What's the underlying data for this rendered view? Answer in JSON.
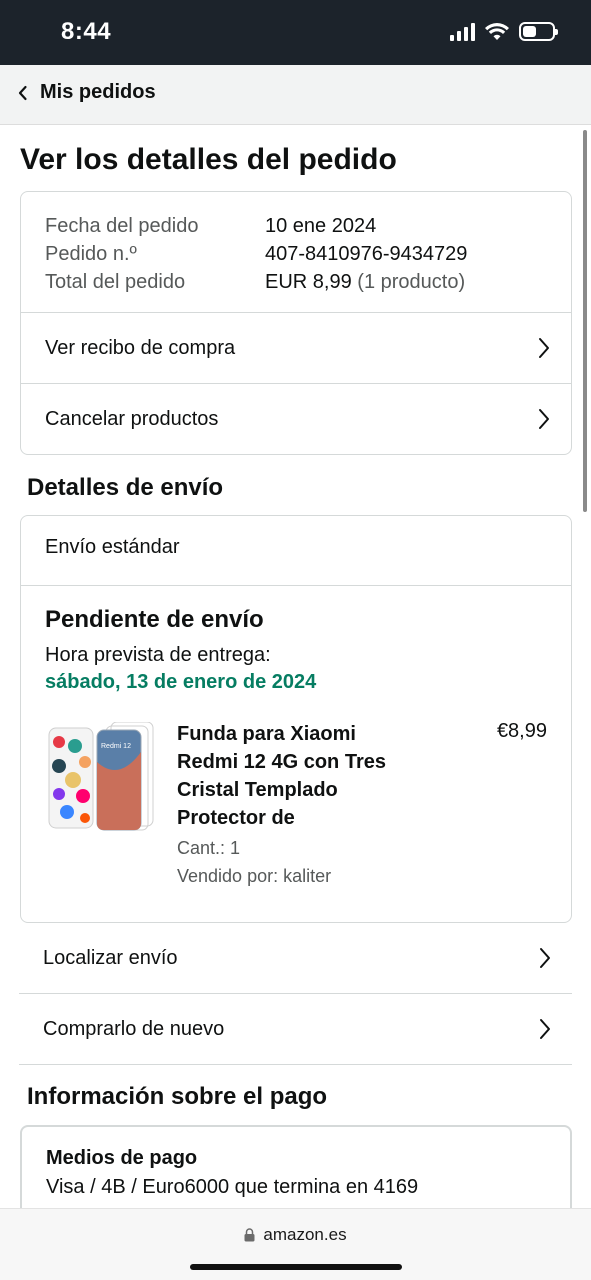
{
  "status_bar": {
    "time": "8:44"
  },
  "nav": {
    "back_label": "Mis pedidos"
  },
  "page_title": "Ver los detalles del pedido",
  "order_summary": {
    "date_label": "Fecha del pedido",
    "date_value": "10 ene 2024",
    "number_label": "Pedido n.º",
    "number_value": "407-8410976-9434729",
    "total_label": "Total del pedido",
    "total_value": "EUR 8,99",
    "total_count": "(1 producto)"
  },
  "order_actions": [
    {
      "label": "Ver recibo de compra"
    },
    {
      "label": "Cancelar productos"
    }
  ],
  "shipping": {
    "section_title": "Detalles de envío",
    "method": "Envío estándar",
    "status": "Pendiente de envío",
    "delivery_label": "Hora prevista de entrega:",
    "delivery_date": "sábado, 13 de enero de 2024",
    "delivery_date_color": "#067d62",
    "product": {
      "title": "Funda para Xiaomi Redmi 12 4G con Tres Cristal Templado Protector de",
      "price": "€8,99",
      "quantity": "Cant.: 1",
      "seller": "Vendido por: kaliter",
      "image_text": "Redmi 12"
    }
  },
  "shipping_actions": [
    {
      "label": "Localizar envío"
    },
    {
      "label": "Comprarlo de nuevo"
    }
  ],
  "payment": {
    "section_title": "Información sobre el pago",
    "title": "Medios de pago",
    "value": "Visa / 4B / Euro6000  que termina en 4169"
  },
  "browser": {
    "url": "amazon.es"
  }
}
